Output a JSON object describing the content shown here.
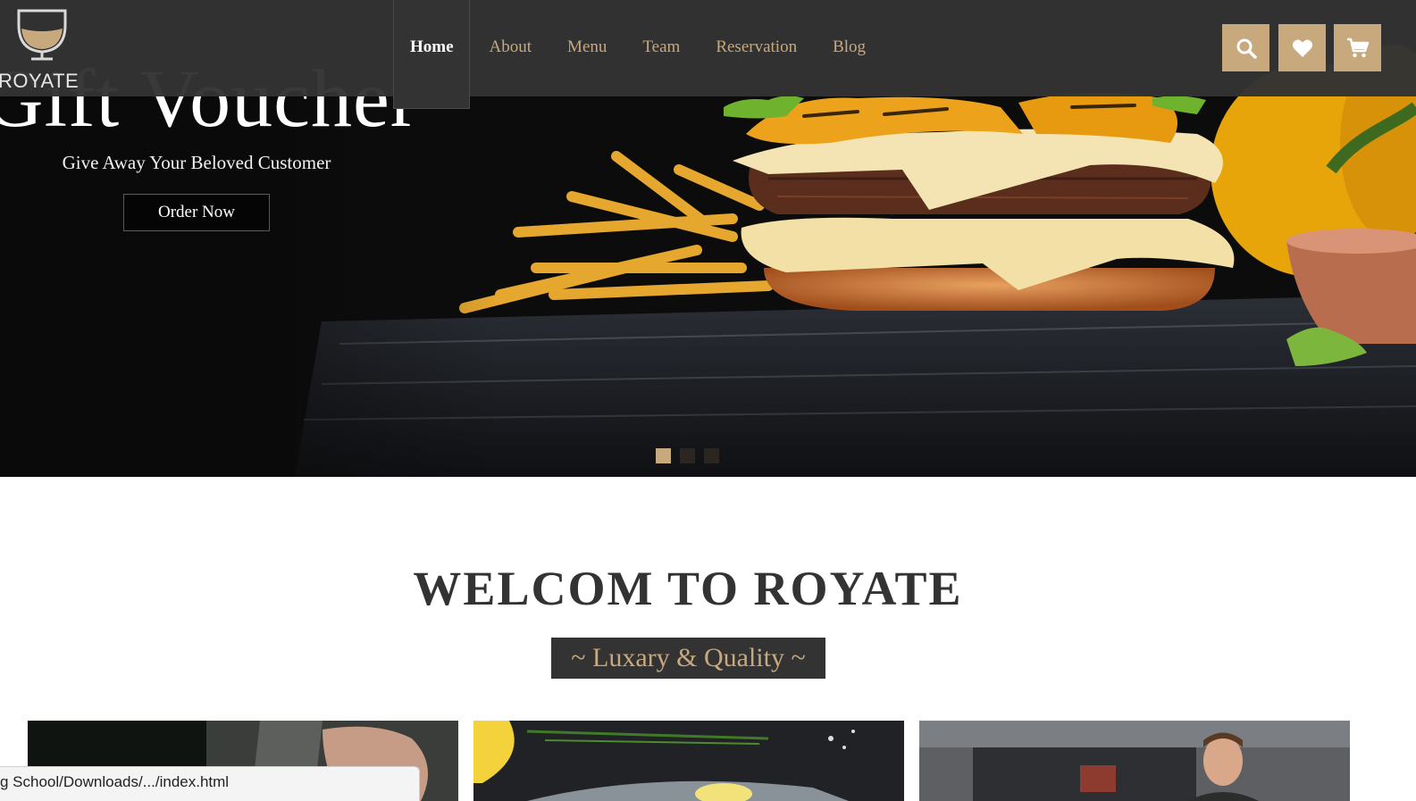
{
  "brand": {
    "name": "ROYATE",
    "logo_icon": "wine-glass-icon"
  },
  "nav": {
    "items": [
      {
        "label": "Home",
        "active": true
      },
      {
        "label": "About"
      },
      {
        "label": "Menu"
      },
      {
        "label": "Team"
      },
      {
        "label": "Reservation"
      },
      {
        "label": "Blog"
      }
    ]
  },
  "actions": {
    "search_icon": "search-icon",
    "wishlist_icon": "heart-icon",
    "cart_icon": "cart-icon"
  },
  "hero": {
    "title": "Gift Voucher",
    "subtitle": "Give Away Your Beloved Customer",
    "cta_label": "Order Now",
    "slides": 3,
    "active_slide": 1
  },
  "welcome": {
    "title": "WELCOM TO ROYATE",
    "tagline": "~ Luxary & Quality ~"
  },
  "status_bar": {
    "url": "g School/Downloads/.../index.html"
  },
  "colors": {
    "accent": "#c8a97e",
    "dark": "#333333",
    "hero_bg": "#0c0c0d"
  }
}
